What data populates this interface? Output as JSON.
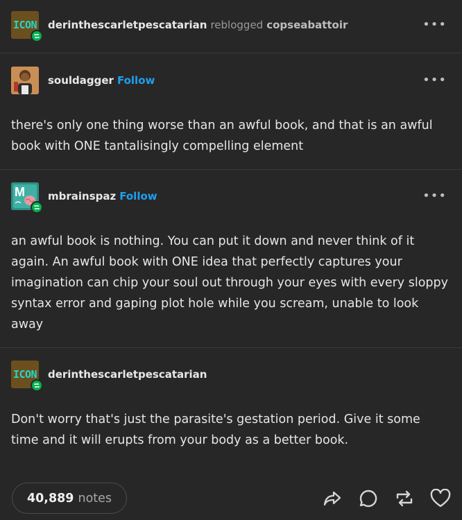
{
  "header": {
    "blog_name": "derinthescarletpescatarian",
    "action": "reblogged",
    "source_blog": "copseabattoir",
    "avatar_text": "ICON"
  },
  "posts": [
    {
      "username": "souldagger",
      "follow_label": "Follow",
      "body": "there's only one thing worse than an awful book, and that is an awful book with ONE tantalisingly compelling element"
    },
    {
      "username": "mbrainspaz",
      "follow_label": "Follow",
      "avatar_text": "M",
      "body": "an awful book is nothing. You can put it down and never think of it again. An awful book with ONE idea that perfectly captures your imagination can chip your soul out through your eyes with every sloppy syntax error and gaping plot hole while you scream, unable to look away"
    },
    {
      "username": "derinthescarletpescatarian",
      "avatar_text": "ICON",
      "body": "Don't worry that's just the parasite's gestation period. Give it some time and it will erupts from your body as a better book."
    }
  ],
  "footer": {
    "notes_count": "40,889",
    "notes_label": "notes"
  },
  "colors": {
    "background": "#272727",
    "follow": "#1ea0f0",
    "reblog_badge": "#03b04f"
  },
  "icons": [
    "reblog-badge-icon",
    "more-options-icon",
    "share-icon",
    "reply-icon",
    "reblog-icon",
    "like-icon"
  ]
}
